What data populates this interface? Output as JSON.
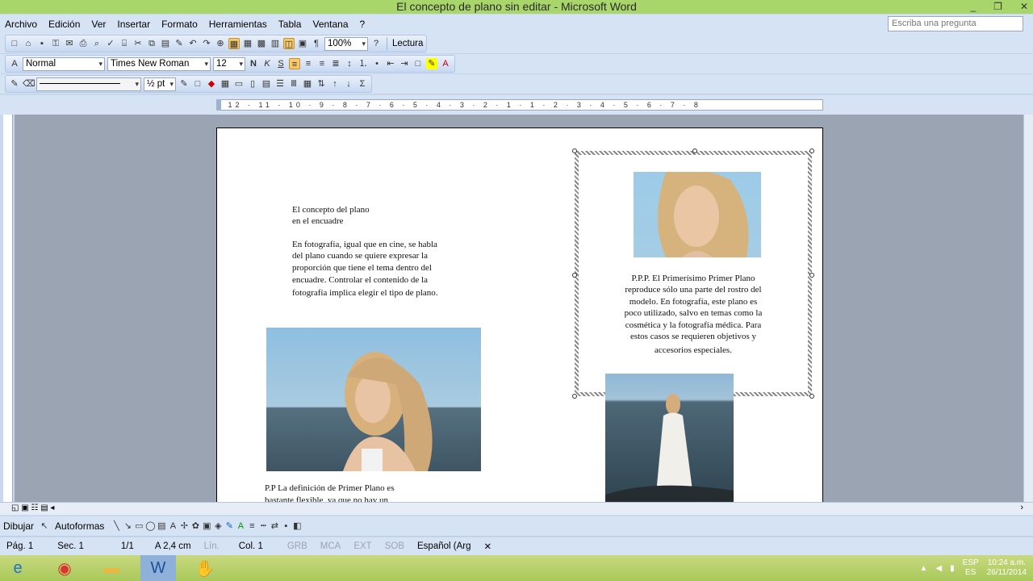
{
  "window": {
    "title": "El concepto de plano sin editar - Microsoft Word",
    "minimize": "_",
    "restore": "❐",
    "close": "✕"
  },
  "menu": {
    "items": [
      "Archivo",
      "Edición",
      "Ver",
      "Insertar",
      "Formato",
      "Herramientas",
      "Tabla",
      "Ventana",
      "?"
    ],
    "ask_placeholder": "Escriba una pregunta"
  },
  "toolbar": {
    "zoom": "100%",
    "reading": "Lectura"
  },
  "format": {
    "style": "Normal",
    "font": "Times New Roman",
    "size": "12"
  },
  "drawing_tb": {
    "line_weight": "½ pt"
  },
  "ruler": {
    "marks": "· 12 · 11 · 10 · 9 · 8 · 7 · 6 · 5 · 4 · 3 · 2 · 1 · 1 · 2 · 3 · 4 · 5 · 6 · 7 · 8"
  },
  "document": {
    "heading_line1": "El concepto del plano",
    "heading_line2": "en el encuadre",
    "para1": [
      "En fotografía, igual que en cine, se habla",
      "del plano cuando se quiere expresar la",
      "proporción que tiene el tema dentro del",
      "encuadre. Controlar el contenido de la",
      "fotografía implica elegir el tipo de plano."
    ],
    "pp_line1": "P.P La definición de Primer Plano es",
    "pp_line2": "bastante flexible, ya que no hay un",
    "ppp": [
      "P.P.P. El Primerísimo Primer Plano",
      "reproduce sólo una parte del rostro del",
      "modelo. En fotografía, este plano es",
      "poco utilizado, salvo en temas como la",
      "cosmética y la fotografía médica. Para",
      "estos casos se requieren objetivos y",
      "accesorios especiales."
    ]
  },
  "drawbar": {
    "draw": "Dibujar",
    "autoshapes": "Autoformas"
  },
  "status": {
    "page": "Pág. 1",
    "section": "Sec. 1",
    "pages": "1/1",
    "at": "A 2,4 cm",
    "line": "Lín.",
    "col": "Col. 1",
    "grb": "GRB",
    "mca": "MCA",
    "ext": "EXT",
    "sob": "SOB",
    "lang": "Español (Arg"
  },
  "tray": {
    "lang1": "ESP",
    "lang2": "ES",
    "time": "10:24 a.m.",
    "date": "26/11/2014"
  }
}
